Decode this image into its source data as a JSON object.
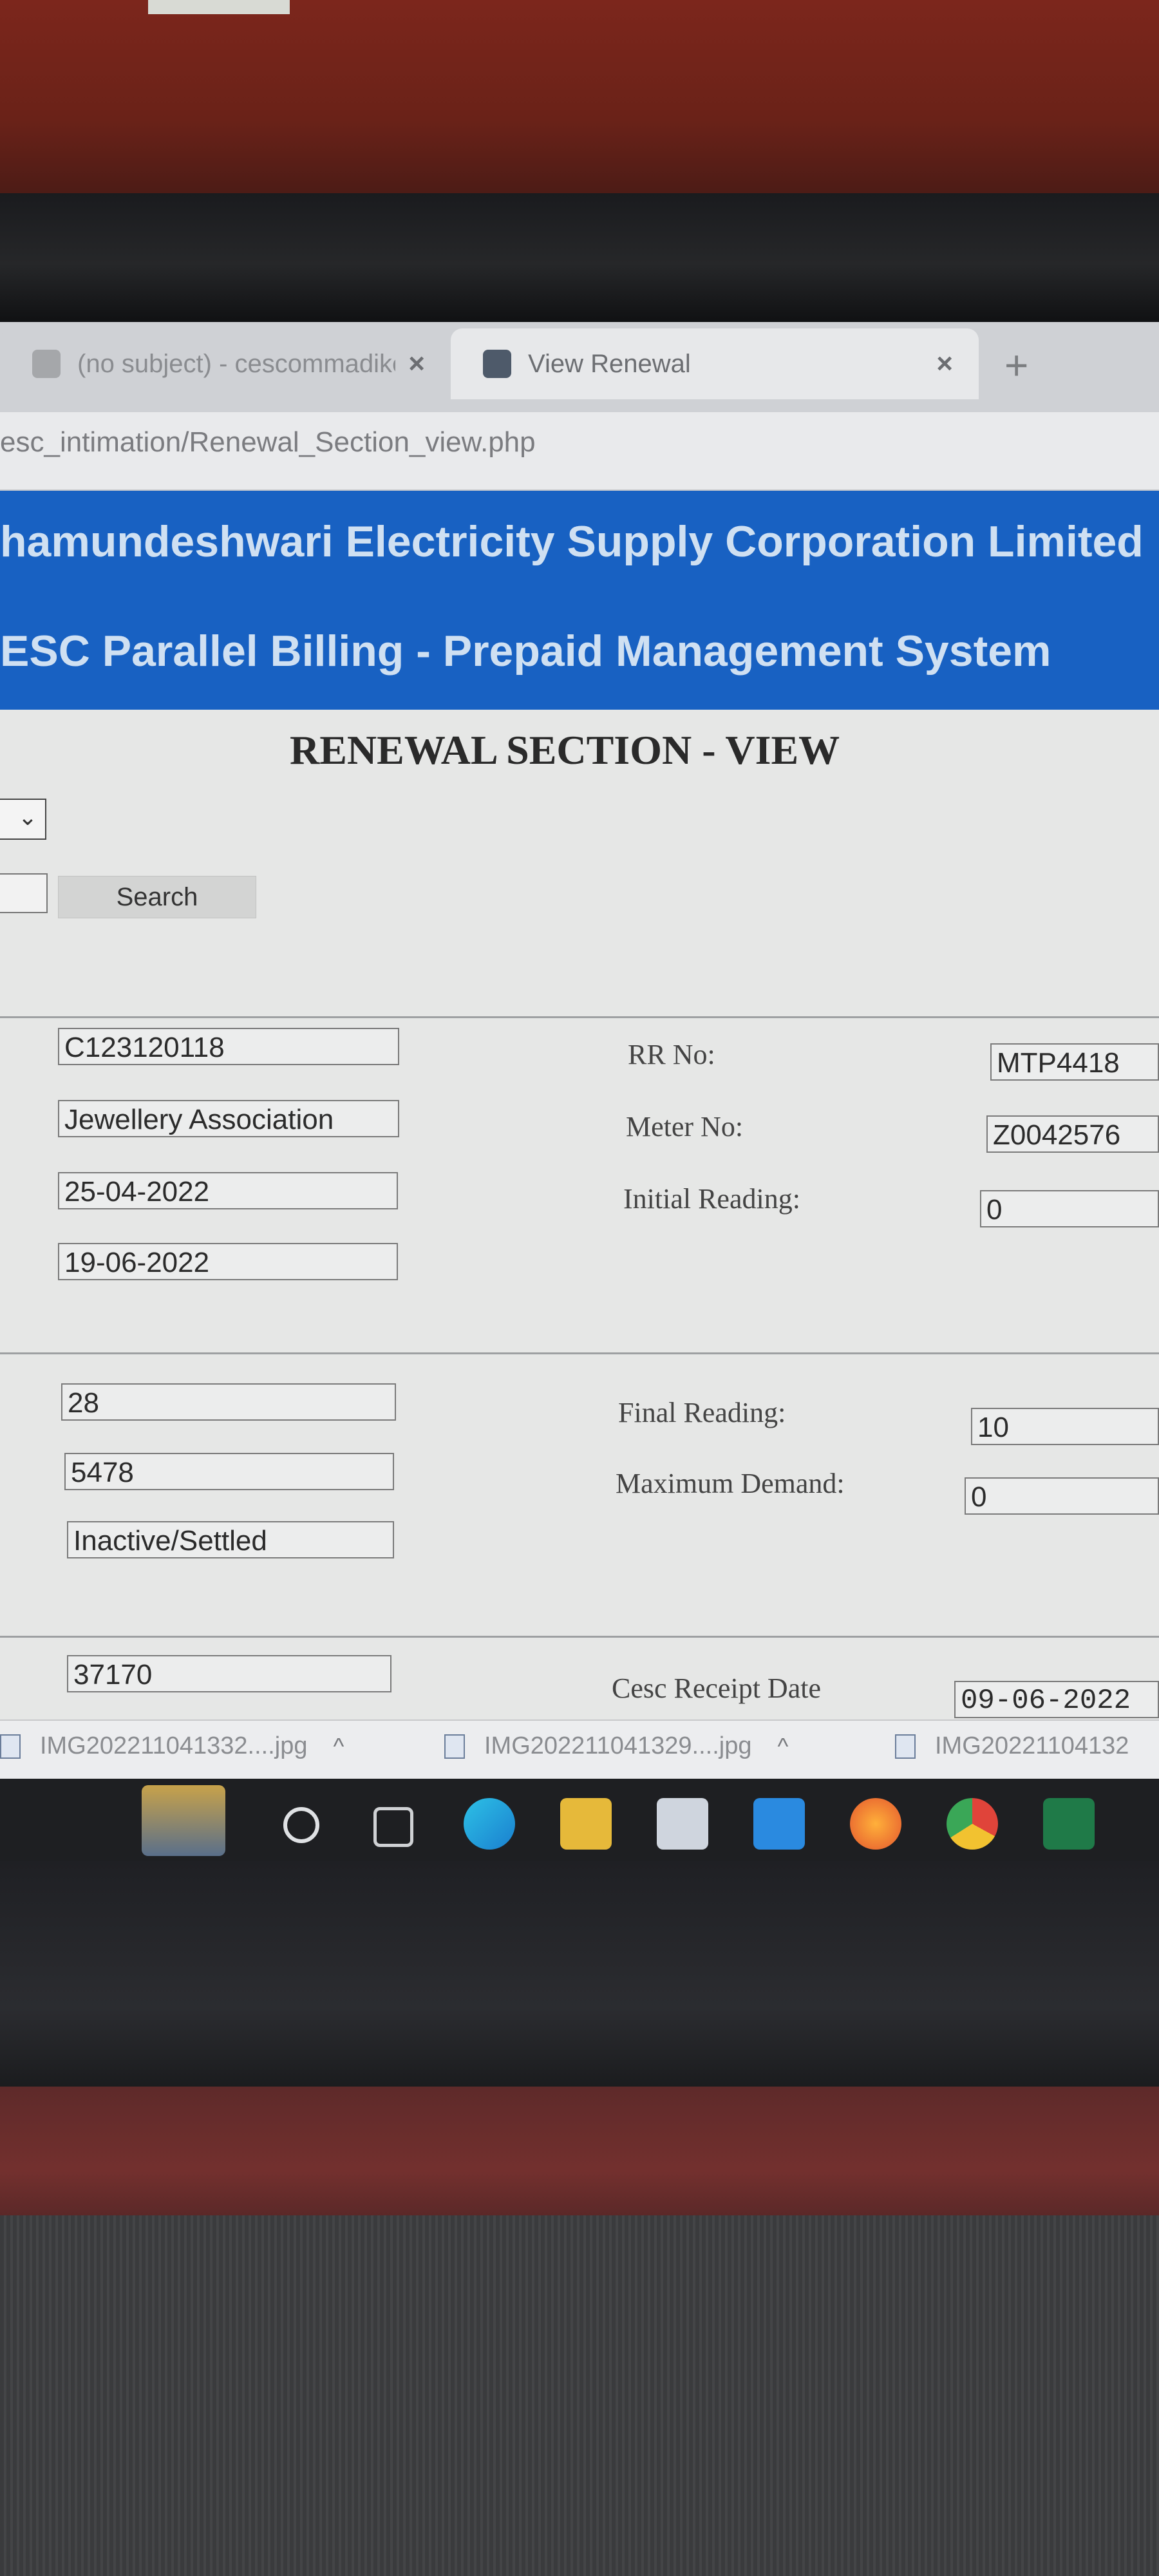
{
  "browser": {
    "tabs": [
      {
        "title": "(no subject) - cescommadikeri@",
        "active": false
      },
      {
        "title": "View Renewal",
        "active": true
      }
    ],
    "close_icon": "×",
    "new_tab_icon": "+",
    "url": "esc_intimation/Renewal_Section_view.php"
  },
  "header": {
    "line1": "hamundeshwari Electricity Supply Corporation Limited",
    "line2": "ESC Parallel Billing - Prepaid Management System",
    "bg_color": "#1861c2"
  },
  "page": {
    "title": "RENEWAL SECTION - VIEW",
    "search_button": "Search"
  },
  "section1": {
    "left_values": [
      "C123120118",
      "Jewellery Association",
      "25-04-2022",
      "19-06-2022"
    ],
    "labels": [
      "RR No:",
      "Meter No:",
      "Initial Reading:"
    ],
    "right_values": [
      "MTP4418",
      "Z0042576",
      "0"
    ]
  },
  "section2": {
    "left_values": [
      "28",
      "5478",
      "Inactive/Settled"
    ],
    "labels": [
      "Final Reading:",
      "Maximum Demand:"
    ],
    "right_values": [
      "10",
      "0"
    ]
  },
  "section3": {
    "left_value": "37170",
    "label": "Cesc Receipt Date",
    "right_value": "09-06-2022"
  },
  "downloads": [
    {
      "name": "IMG202211041332....jpg"
    },
    {
      "name": "IMG202211041329....jpg"
    },
    {
      "name": "IMG20221104132"
    }
  ],
  "icons": {
    "chevron": "⌄",
    "download_chevron": "^"
  }
}
